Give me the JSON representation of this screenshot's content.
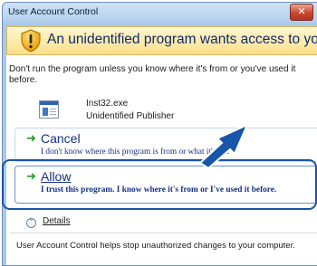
{
  "window": {
    "title": "User Account Control",
    "close_icon": "close-icon"
  },
  "warning": {
    "text": "An unidentified program wants access to your computer",
    "icon": "shield-warning-icon",
    "accent": "#f0b000"
  },
  "intro": {
    "text": "Don't run the program unless you know where it's from or you've used it before."
  },
  "program": {
    "name": "Inst32.exe",
    "publisher": "Unidentified Publisher",
    "icon": "program-icon"
  },
  "options": {
    "cancel": {
      "title": "Cancel",
      "description": "I don't know where this program is from or what it's for.",
      "icon": "green-arrow-icon"
    },
    "allow": {
      "title": "Allow",
      "description": "I trust this program. I know where it's from or I've used it before.",
      "icon": "green-arrow-icon"
    }
  },
  "details": {
    "label": "Details",
    "icon": "chevron-down-icon"
  },
  "footer": {
    "text": "User Account Control helps stop unauthorized changes to your computer."
  },
  "annotation": {
    "highlight_color": "#1756a8",
    "pointer_color": "#1756a8"
  }
}
